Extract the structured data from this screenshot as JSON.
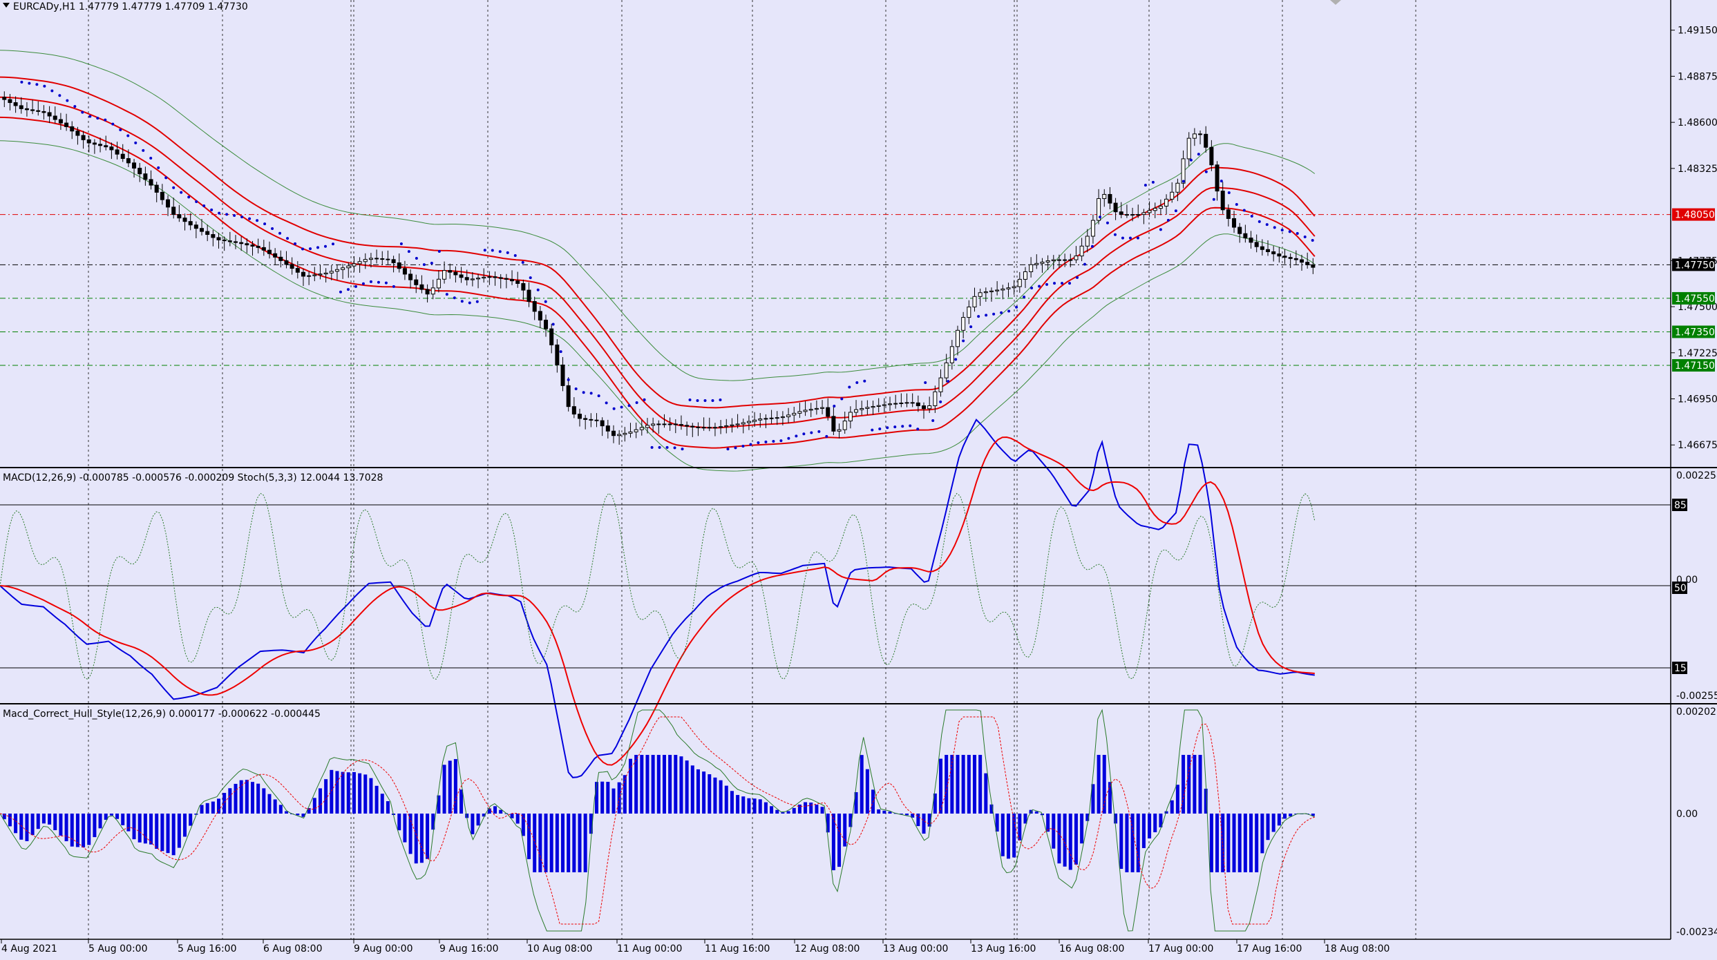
{
  "window": {
    "symbol_header": "EURCADy,H1  1.47779 1.47779 1.47709 1.47730",
    "macd_header": "MACD(12,26,9) -0.000785 -0.000576 -0.000209  Stoch(5,3,3) 12.0044 13.7028",
    "hull_header": "Macd_Correct_Hull_Style(12,26,9) 0.000177 -0.000622 -0.000445"
  },
  "colors": {
    "background": "#e6e6fa",
    "price_red": "#e00000",
    "bollinger_green": "#3c8c3c",
    "psar_blue": "#0000cc",
    "macd_blue": "#0000dd",
    "signal_red": "#ee0000",
    "stoch_green": "#2a7a2a",
    "level_red_tag": "#e00000",
    "level_green_tag": "#008000",
    "current_price_tag": "#000000"
  },
  "price_axis": {
    "ticks": [
      "1.49150",
      "1.48875",
      "1.48600",
      "1.48325",
      "1.47775",
      "1.47500",
      "1.47225",
      "1.46950",
      "1.46675"
    ],
    "tick_values": [
      1.4915,
      1.48875,
      1.486,
      1.48325,
      1.47775,
      1.475,
      1.47225,
      1.4695,
      1.46675
    ],
    "range": [
      1.4654,
      1.4933
    ]
  },
  "levels": [
    {
      "label": "1.48050",
      "value": 1.4805,
      "type": "red"
    },
    {
      "label": "1.47750",
      "value": 1.4775,
      "type": "current"
    },
    {
      "label": "1.47550",
      "value": 1.4755,
      "type": "green"
    },
    {
      "label": "1.47350",
      "value": 1.4735,
      "type": "green"
    },
    {
      "label": "1.47150",
      "value": 1.4715,
      "type": "green"
    }
  ],
  "macd_axis": {
    "top": "0.002258",
    "mid": "0.00",
    "bottom": "-0.002556",
    "stoch_levels": [
      "85",
      "50",
      "15"
    ]
  },
  "hull_axis": {
    "top": "0.002021",
    "mid": "0.00",
    "bottom": "-0.002343"
  },
  "time_axis": [
    "4 Aug 2021",
    "5 Aug 00:00",
    "5 Aug 16:00",
    "6 Aug 08:00",
    "9 Aug 00:00",
    "9 Aug 16:00",
    "10 Aug 08:00",
    "11 Aug 00:00",
    "11 Aug 16:00",
    "12 Aug 08:00",
    "13 Aug 00:00",
    "13 Aug 16:00",
    "16 Aug 08:00",
    "17 Aug 00:00",
    "17 Aug 16:00",
    "18 Aug 08:00"
  ],
  "chart_data": {
    "type": "candlestick",
    "symbol": "EURCADy",
    "timeframe": "H1",
    "close_path": [
      [
        0,
        1.4875
      ],
      [
        20,
        1.4868
      ],
      [
        40,
        1.4866
      ],
      [
        60,
        1.4858
      ],
      [
        80,
        1.4848
      ],
      [
        100,
        1.4845
      ],
      [
        120,
        1.4835
      ],
      [
        140,
        1.4822
      ],
      [
        160,
        1.4805
      ],
      [
        180,
        1.4797
      ],
      [
        200,
        1.479
      ],
      [
        220,
        1.4788
      ],
      [
        240,
        1.4785
      ],
      [
        260,
        1.4777
      ],
      [
        280,
        1.4768
      ],
      [
        300,
        1.477
      ],
      [
        320,
        1.4774
      ],
      [
        340,
        1.4779
      ],
      [
        360,
        1.4778
      ],
      [
        380,
        1.4765
      ],
      [
        395,
        1.4757
      ],
      [
        410,
        1.4772
      ],
      [
        430,
        1.4766
      ],
      [
        450,
        1.4768
      ],
      [
        470,
        1.4766
      ],
      [
        480,
        1.4763
      ],
      [
        490,
        1.475
      ],
      [
        505,
        1.4735
      ],
      [
        515,
        1.4712
      ],
      [
        525,
        1.4688
      ],
      [
        535,
        1.4683
      ],
      [
        550,
        1.4682
      ],
      [
        565,
        1.4673
      ],
      [
        580,
        1.4675
      ],
      [
        600,
        1.468
      ],
      [
        620,
        1.468
      ],
      [
        640,
        1.4678
      ],
      [
        660,
        1.4678
      ],
      [
        680,
        1.468
      ],
      [
        700,
        1.4683
      ],
      [
        720,
        1.4684
      ],
      [
        740,
        1.4688
      ],
      [
        760,
        1.469
      ],
      [
        770,
        1.4673
      ],
      [
        785,
        1.4688
      ],
      [
        800,
        1.469
      ],
      [
        820,
        1.4692
      ],
      [
        840,
        1.4693
      ],
      [
        855,
        1.4688
      ],
      [
        870,
        1.4712
      ],
      [
        885,
        1.474
      ],
      [
        900,
        1.4758
      ],
      [
        920,
        1.476
      ],
      [
        935,
        1.4762
      ],
      [
        950,
        1.4775
      ],
      [
        970,
        1.4778
      ],
      [
        990,
        1.4778
      ],
      [
        1005,
        1.4795
      ],
      [
        1015,
        1.482
      ],
      [
        1030,
        1.4805
      ],
      [
        1050,
        1.4805
      ],
      [
        1070,
        1.481
      ],
      [
        1085,
        1.4822
      ],
      [
        1095,
        1.485
      ],
      [
        1105,
        1.4855
      ],
      [
        1115,
        1.484
      ],
      [
        1125,
        1.481
      ],
      [
        1140,
        1.4795
      ],
      [
        1160,
        1.4785
      ],
      [
        1180,
        1.478
      ],
      [
        1195,
        1.4778
      ],
      [
        1212,
        1.4773
      ]
    ],
    "y_range": [
      1.4654,
      1.4933
    ]
  }
}
